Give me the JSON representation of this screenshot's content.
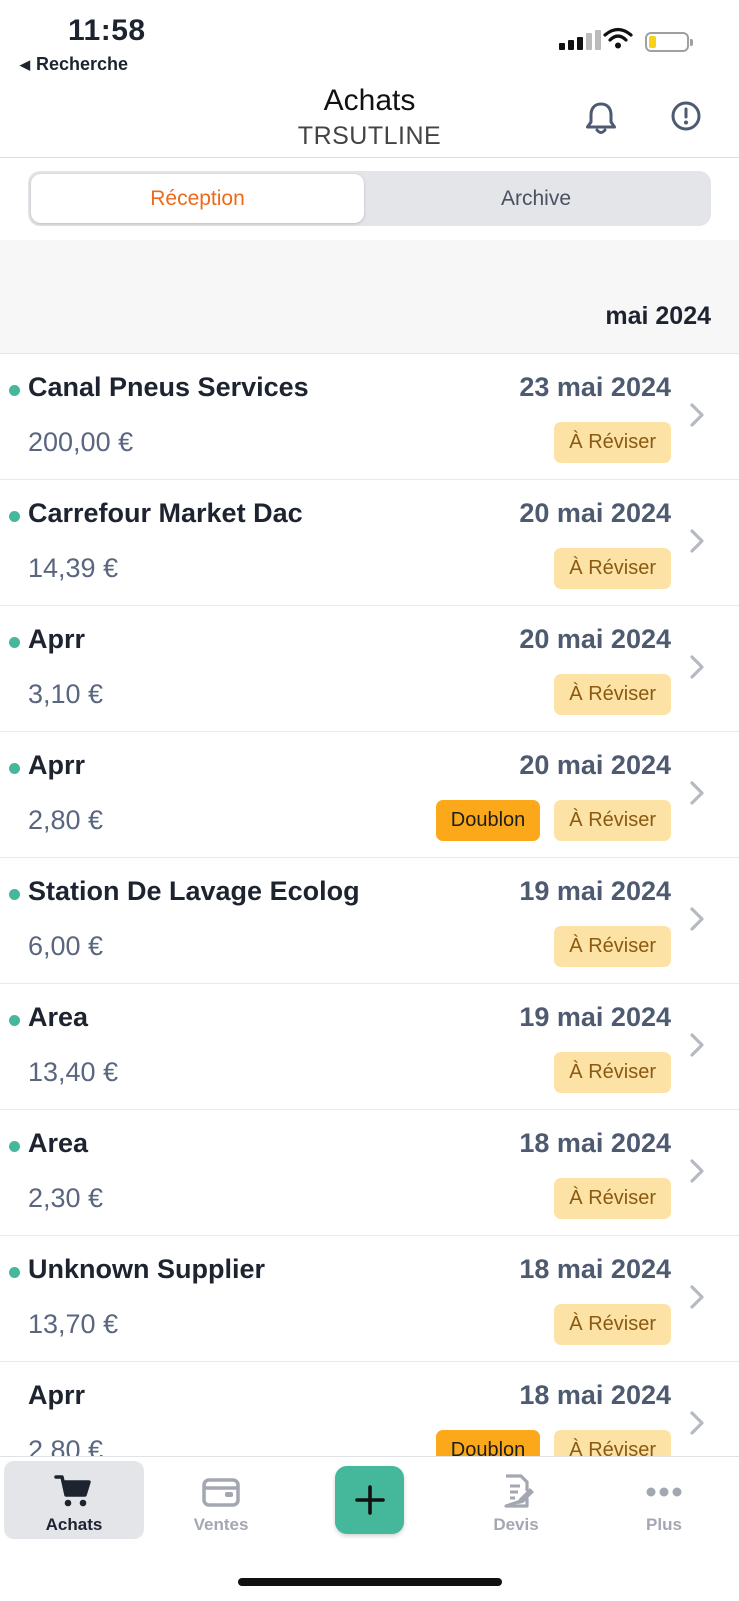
{
  "status_bar": {
    "time": "11:58",
    "back_label": "Recherche"
  },
  "header": {
    "title": "Achats",
    "subtitle": "TRSUTLINE",
    "icons": [
      "bell-icon",
      "info-icon"
    ]
  },
  "tabs": [
    {
      "label": "Réception",
      "active": true
    },
    {
      "label": "Archive",
      "active": false
    }
  ],
  "month_header": "mai 2024",
  "colors": {
    "accent": "#ee6a1a",
    "unread_dot": "#45b89b",
    "badge_review_bg": "#fde2a6",
    "badge_duplicate_bg": "#fba81a",
    "fab": "#45b89b"
  },
  "purchases": [
    {
      "supplier": "Canal Pneus Services",
      "date": "23 mai 2024",
      "amount": "200,00 €",
      "unread": true,
      "badges": [
        "À Réviser"
      ]
    },
    {
      "supplier": "Carrefour Market Dac",
      "date": "20 mai 2024",
      "amount": "14,39 €",
      "unread": true,
      "badges": [
        "À Réviser"
      ]
    },
    {
      "supplier": "Aprr",
      "date": "20 mai 2024",
      "amount": "3,10 €",
      "unread": true,
      "badges": [
        "À Réviser"
      ]
    },
    {
      "supplier": "Aprr",
      "date": "20 mai 2024",
      "amount": "2,80 €",
      "unread": true,
      "badges": [
        "Doublon",
        "À Réviser"
      ]
    },
    {
      "supplier": "Station De Lavage Ecolog",
      "date": "19 mai 2024",
      "amount": "6,00 €",
      "unread": true,
      "badges": [
        "À Réviser"
      ]
    },
    {
      "supplier": "Area",
      "date": "19 mai 2024",
      "amount": "13,40 €",
      "unread": true,
      "badges": [
        "À Réviser"
      ]
    },
    {
      "supplier": "Area",
      "date": "18 mai 2024",
      "amount": "2,30 €",
      "unread": true,
      "badges": [
        "À Réviser"
      ]
    },
    {
      "supplier": "Unknown Supplier",
      "date": "18 mai 2024",
      "amount": "13,70 €",
      "unread": true,
      "badges": [
        "À Réviser"
      ]
    },
    {
      "supplier": "Aprr",
      "date": "18 mai 2024",
      "amount": "2,80 €",
      "unread": false,
      "badges": [
        "Doublon",
        "À Réviser"
      ]
    }
  ],
  "bottom_nav": [
    {
      "label": "Achats",
      "icon": "cart-icon",
      "active": true
    },
    {
      "label": "Ventes",
      "icon": "wallet-icon",
      "active": false
    },
    {
      "label": "",
      "icon": "plus-icon",
      "active": false
    },
    {
      "label": "Devis",
      "icon": "document-edit-icon",
      "active": false
    },
    {
      "label": "Plus",
      "icon": "more-dots-icon",
      "active": false
    }
  ]
}
